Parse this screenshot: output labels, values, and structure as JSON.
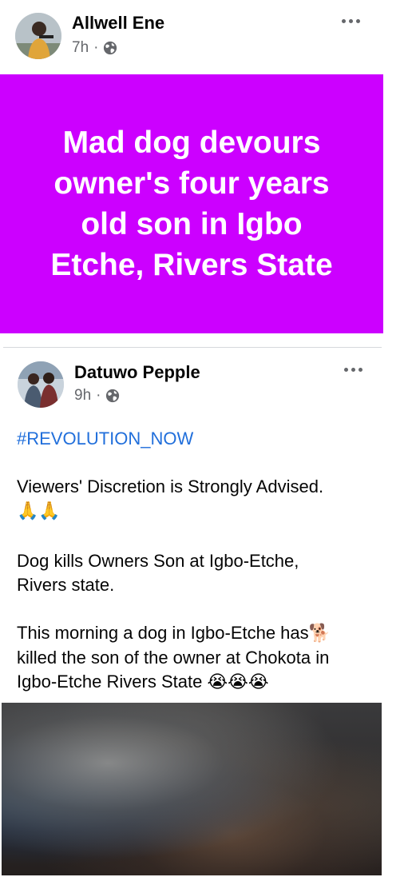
{
  "post1": {
    "author": "Allwell Ene",
    "time": "7h",
    "separator": "·",
    "privacy_icon": "globe-icon",
    "more_icon": "more-horizontal-icon",
    "text_card": {
      "text": "Mad dog devours owner's four years old son in Igbo Etche, Rivers State",
      "background": "#cc00ff",
      "text_color": "#ffffff"
    }
  },
  "post2": {
    "author": "Datuwo Pepple",
    "time": "9h",
    "separator": "·",
    "privacy_icon": "globe-icon",
    "more_icon": "more-horizontal-icon",
    "hashtag": "#REVOLUTION_NOW",
    "hashtag_color": "#216fdb",
    "paragraph1": "Viewers' Discretion is Strongly Advised.",
    "paragraph1_emoji": "🙏🙏",
    "paragraph2": "Dog kills Owners Son at Igbo-Etche, Rivers state.",
    "paragraph3": "This morning a dog in Igbo-Etche has",
    "paragraph3_emoji": "🐕",
    "paragraph3b": "killed the son of the owner at Chokota in Igbo-Etche Rivers State",
    "paragraph3_end_emoji": "😭😭😭",
    "media": "blurred-image"
  }
}
